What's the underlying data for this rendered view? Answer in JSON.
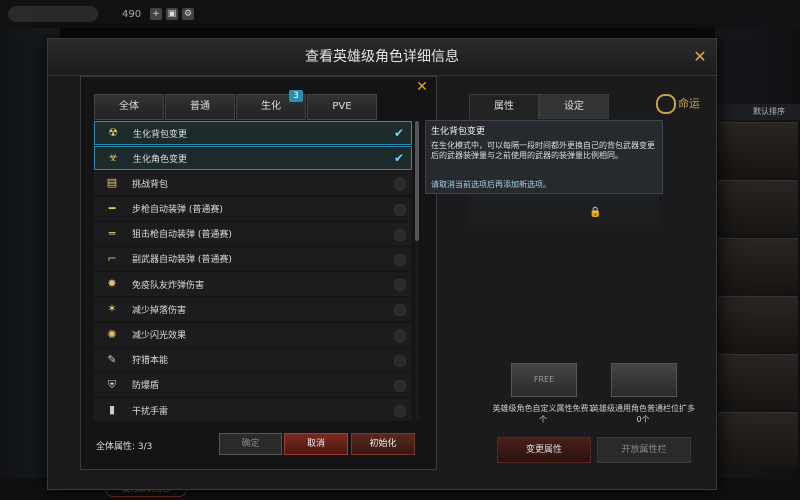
{
  "topbar": {
    "value": "490"
  },
  "modal": {
    "title": "查看英雄级角色详细信息"
  },
  "filter_tabs": [
    {
      "label": "全体"
    },
    {
      "label": "普通"
    },
    {
      "label": "生化",
      "badge": "3"
    },
    {
      "label": "PVE"
    }
  ],
  "options": [
    {
      "label": "生化背包变更",
      "icon": "biohazard-backpack-icon",
      "checked": true
    },
    {
      "label": "生化角色变更",
      "icon": "biohazard-character-icon",
      "checked": true
    },
    {
      "label": "挑战背包",
      "icon": "backpack-icon",
      "checked": false
    },
    {
      "label": "步枪自动装弹 (普通赛)",
      "icon": "rifle-icon",
      "checked": false
    },
    {
      "label": "狙击枪自动装弹 (普通赛)",
      "icon": "sniper-icon",
      "checked": false
    },
    {
      "label": "副武器自动装弹 (普通赛)",
      "icon": "pistol-icon",
      "checked": false
    },
    {
      "label": "免疫队友炸弹伤害",
      "icon": "explosion-icon",
      "checked": false
    },
    {
      "label": "减少掉落伤害",
      "icon": "fall-icon",
      "checked": false
    },
    {
      "label": "减少闪光效果",
      "icon": "flash-icon",
      "checked": false
    },
    {
      "label": "狩猎本能",
      "icon": "instinct-icon",
      "checked": false
    },
    {
      "label": "防爆盾",
      "icon": "shield-icon",
      "checked": false
    },
    {
      "label": "干扰手雷",
      "icon": "grenade-icon",
      "checked": false
    }
  ],
  "footer": {
    "total_label": "全体属性: 3/3",
    "confirm": "确定",
    "cancel": "取消",
    "reset": "初始化"
  },
  "right_tabs": [
    {
      "label": "属性"
    },
    {
      "label": "设定"
    }
  ],
  "logo_text": "命运",
  "tooltip": {
    "title": "生化背包变更",
    "desc": "在生化模式中，可以每隔一段时间都外更换自己的背包武器变更后的武器装弹量与之前使用的武器的装弹量比例相同。",
    "note": "请取消当前选项后再添加新选项。"
  },
  "cards": [
    {
      "caption": "英雄级角色自定义属性免费1个",
      "label": "FREE"
    },
    {
      "caption": "英雄级通用角色普通栏位扩多0个",
      "label": ""
    }
  ],
  "right_buttons": {
    "change": "变更属性",
    "open": "开放属性栏"
  },
  "rightbar": {
    "head": "默认排序"
  },
  "bottom": {
    "pill": "设为默认角色"
  }
}
